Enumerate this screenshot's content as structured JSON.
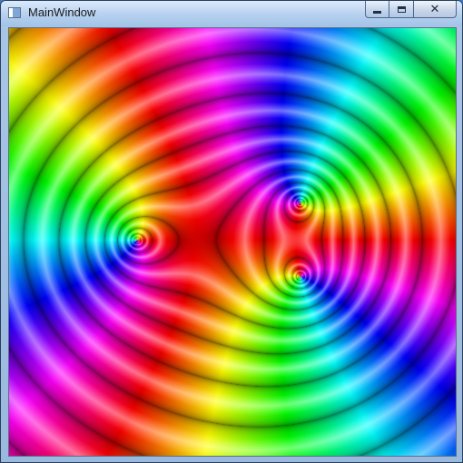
{
  "window": {
    "title": "MainWindow",
    "icon": "app-window-icon",
    "caption_buttons": {
      "minimize": "minimize-icon",
      "maximize": "maximize-icon",
      "close": "close-icon"
    }
  },
  "plot": {
    "description_type": "domain-coloring-of-complex-function",
    "zeros": [
      {
        "re": -0.88,
        "im": 0.02
      },
      {
        "re": 0.62,
        "im": 0.38
      },
      {
        "re": 0.62,
        "im": -0.33
      }
    ],
    "colors": {
      "hue_cycle": [
        "#ff0000",
        "#ffff00",
        "#00ff00",
        "#00ffff",
        "#0000ff",
        "#ff00ff"
      ]
    }
  }
}
